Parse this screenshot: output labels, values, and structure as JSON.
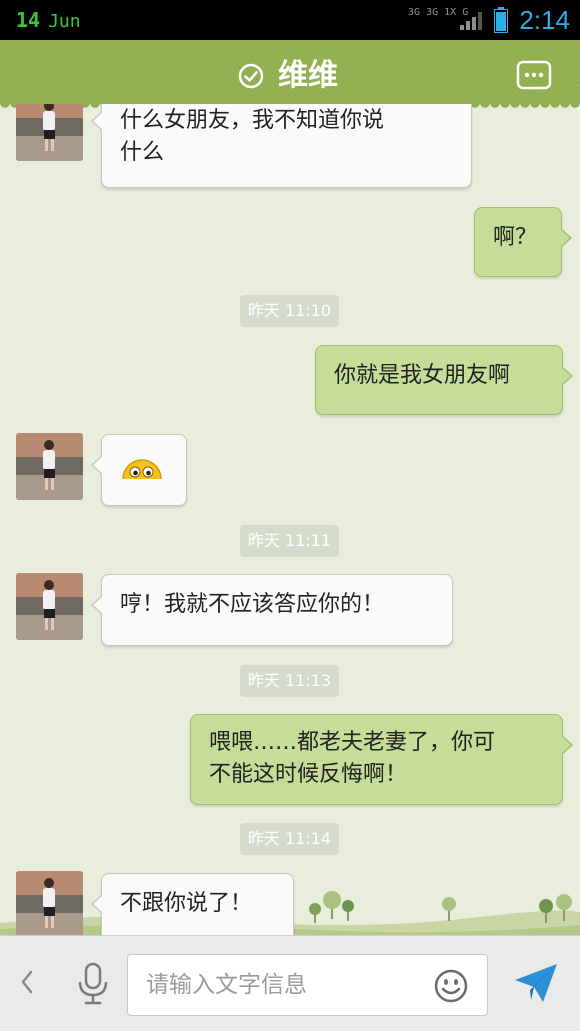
{
  "status_bar": {
    "day": "14",
    "month": "Jun",
    "network_labels": [
      "3G",
      "3G",
      "1X",
      "G"
    ],
    "time": "2:14",
    "date_color": "#39c63c",
    "time_color": "#2eaee4",
    "icons": [
      "signal-icon",
      "battery-icon"
    ]
  },
  "header": {
    "contact_name": "维维",
    "verified_icon": "check-circle-icon",
    "menu_icon": "chat-bubble-menu-icon",
    "color": "#8fae4c"
  },
  "messages": [
    {
      "type": "incoming",
      "text": "什么女朋友，我不知道你说\n什么"
    },
    {
      "type": "outgoing",
      "text": "啊？"
    },
    {
      "type": "timestamp",
      "text": "昨天 11:10"
    },
    {
      "type": "outgoing",
      "text": "你就是我女朋友啊"
    },
    {
      "type": "incoming",
      "emoji": "peeking-face-emoji"
    },
    {
      "type": "timestamp",
      "text": "昨天 11:11"
    },
    {
      "type": "incoming",
      "text": "哼！我就不应该答应你的！"
    },
    {
      "type": "timestamp",
      "text": "昨天 11:13"
    },
    {
      "type": "outgoing",
      "text": "喂喂……都老夫老妻了，你可\n不能这时候反悔啊！"
    },
    {
      "type": "timestamp",
      "text": "昨天 11:14"
    },
    {
      "type": "incoming",
      "text": "不跟你说了！"
    }
  ],
  "input_bar": {
    "placeholder": "请输入文字信息",
    "value": "",
    "icons": [
      "chevron-left-icon",
      "microphone-icon",
      "smiley-icon",
      "send-icon"
    ]
  },
  "colors": {
    "chat_background": "#e8eddc",
    "outgoing_bubble": "#c5dd98",
    "incoming_bubble": "#fafafa",
    "send_icon": "#2d8fd5"
  }
}
